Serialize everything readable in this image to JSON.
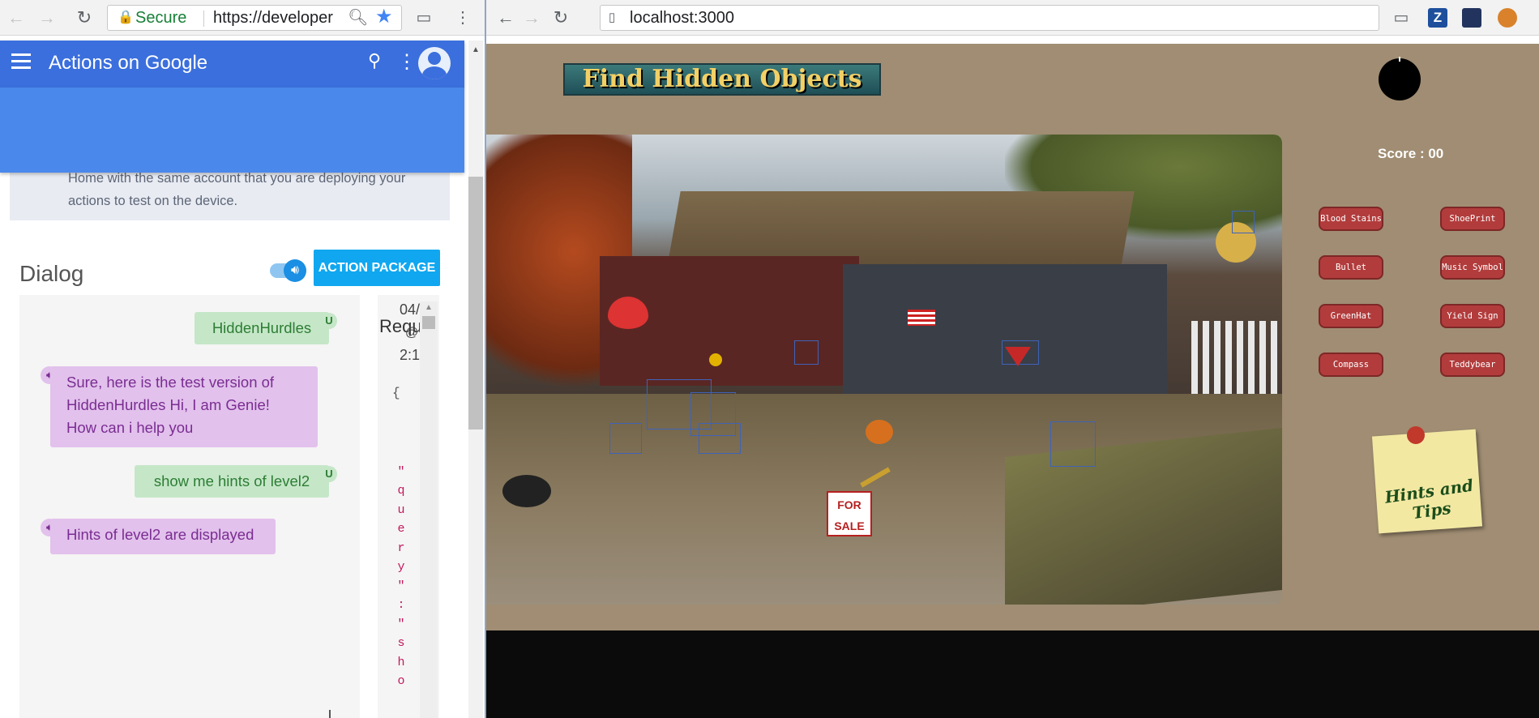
{
  "left_browser": {
    "secure_label": "Secure",
    "url": "https://developer",
    "colors": {
      "secure": "#188038",
      "star": "#4285f4"
    }
  },
  "aog": {
    "title": "Actions on Google",
    "notice": "Home with the same account that you are deploying your actions to test on the device.",
    "dialog_title": "Dialog",
    "action_package": "ACTION PACKAGE",
    "messages": [
      {
        "from": "user",
        "text": "HiddenHurdles",
        "badge": "U"
      },
      {
        "from": "bot",
        "text": "Sure, here is the test version of HiddenHurdles Hi, I am Genie! How can i help you"
      },
      {
        "from": "user",
        "text": "show me hints of level2",
        "badge": "U"
      },
      {
        "from": "bot",
        "text": "Hints of level2 are displayed"
      }
    ],
    "request": {
      "title": "Requ",
      "date": "04/",
      "at": "@",
      "time": "2:1",
      "brace": "{",
      "json_chars": [
        "\"",
        "q",
        "u",
        "e",
        "r",
        "y",
        "\"",
        ":",
        "\"",
        "s",
        "h",
        "o"
      ]
    },
    "colors": {
      "header": "#3b6fdd",
      "user_bubble": "#c5e7c8",
      "bot_bubble": "#e2c1ec"
    }
  },
  "right_browser": {
    "url": "localhost:3000",
    "ext_z": "Z"
  },
  "game": {
    "logo": "Find Hidden Objects",
    "score": "Score : 00",
    "objects": [
      "Blood Stains",
      "ShoePrint",
      "Bullet",
      "Music Symbol",
      "GreenHat",
      "Yield Sign",
      "Compass",
      "Teddybear"
    ],
    "hints_note": "Hints and Tips",
    "scene_sign": "FOR SALE",
    "colors": {
      "background": "#a08d73",
      "button": "#b23c3c"
    }
  }
}
